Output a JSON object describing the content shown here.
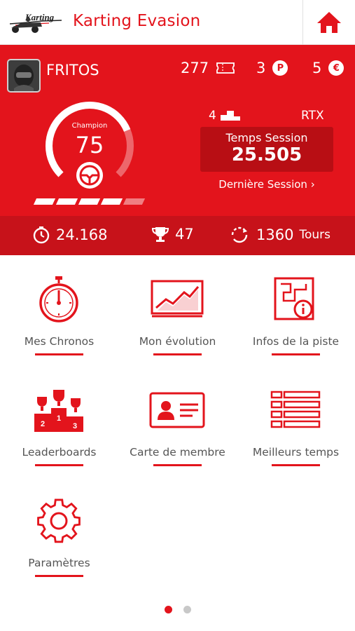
{
  "header": {
    "logo_text": "Karting",
    "title": "Karting Evasion",
    "home_icon": "home-icon"
  },
  "profile": {
    "username": "FRITOS",
    "tickets": "277",
    "points": "3",
    "points_badge": "P",
    "credits": "5",
    "credits_badge": "€",
    "level_label": "Champion",
    "level_value": "75",
    "level_fraction": 0.75,
    "progress_segments_filled": 4,
    "progress_segments_total": 5,
    "position": "4",
    "kart": "RTX",
    "session_label": "Temps Session",
    "session_time": "25.505",
    "last_session_link": "Dernière Session",
    "best_time": "24.168",
    "trophies": "47",
    "laps": "1360",
    "laps_unit": "Tours"
  },
  "menu": [
    {
      "label": "Mes Chronos",
      "icon": "stopwatch-icon"
    },
    {
      "label": "Mon évolution",
      "icon": "chart-icon"
    },
    {
      "label": "Infos de la piste",
      "icon": "track-info-icon"
    },
    {
      "label": "Leaderboards",
      "icon": "podium-icon"
    },
    {
      "label": "Carte de membre",
      "icon": "member-card-icon"
    },
    {
      "label": "Meilleurs temps",
      "icon": "list-icon"
    },
    {
      "label": "Paramètres",
      "icon": "gear-icon"
    }
  ],
  "pager": {
    "pages": 2,
    "current": 1
  },
  "colors": {
    "accent": "#e3141c",
    "accent_dark": "#b80e14",
    "bar": "#c7121a"
  }
}
